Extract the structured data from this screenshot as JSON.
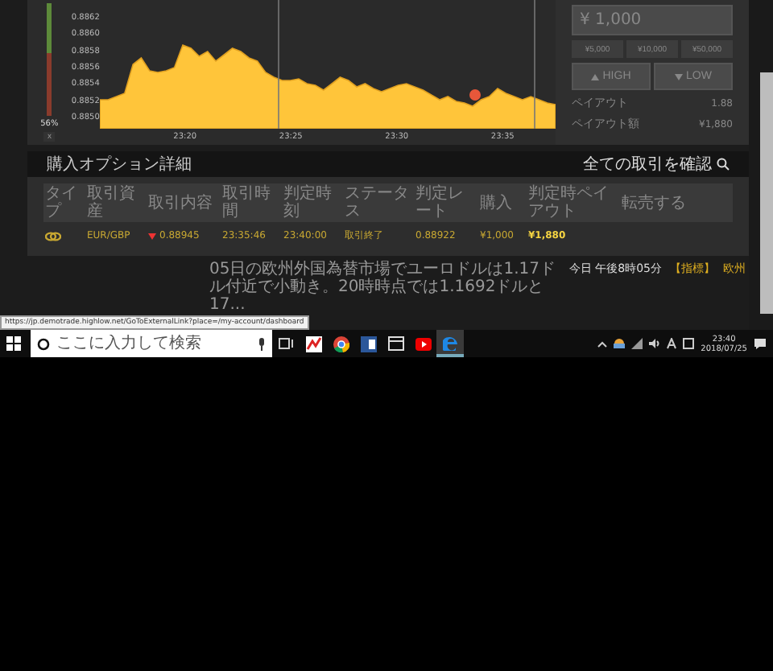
{
  "meter": {
    "label": "56%",
    "close": "x",
    "level": 0.56
  },
  "chart": {
    "yticks": [
      "0.8862",
      "0.8860",
      "0.8858",
      "0.8856",
      "0.8854",
      "0.8852",
      "0.8850"
    ],
    "xticks": [
      "23:20",
      "23:25",
      "23:30",
      "23:35"
    ]
  },
  "trade_panel": {
    "amount": "¥ 1,000",
    "presets": [
      "¥5,000",
      "¥10,000",
      "¥50,000"
    ],
    "buttons": [
      {
        "label": "HIGH",
        "kind": "high"
      },
      {
        "label": "LOW",
        "kind": "low"
      }
    ],
    "payout": [
      {
        "label": "ペイアウト",
        "value": "1.88"
      },
      {
        "label": "ペイアウト額",
        "value": "¥1,880"
      }
    ]
  },
  "options": {
    "title": "購入オプション詳細",
    "link": "全ての取引を確認",
    "columns": [
      "タイプ",
      "取引資産",
      "取引内容",
      "取引時間",
      "判定時刻",
      "ステータス",
      "判定レート",
      "購入",
      "判定時ペイアウト",
      "転売する"
    ],
    "rows": [
      {
        "asset": "EUR/GBP",
        "kind": "low",
        "rate": "0.88945",
        "time": "23:35:46",
        "expiry": "23:40:00",
        "status": "取引終了",
        "closing_rate": "0.88922",
        "amount": "¥1,000",
        "payout": "¥1,880"
      }
    ]
  },
  "ticker": {
    "text": "05日の欧州外国為替市場でユーロドルは1.17ドル付近で小動き。20時時点では1.1692ドルと17...",
    "time": "今日 午後8時05分",
    "tag": "【指標】",
    "headline": "欧州"
  },
  "status_url": "https://jp.demotrade.highlow.net/GoToExternalLink?place=/my-account/dashboard",
  "taskbar": {
    "search_placeholder": "ここに入力して検索",
    "apps": [
      {
        "kind": "highlow",
        "selected": false
      },
      {
        "kind": "chrome",
        "selected": false
      },
      {
        "kind": "word",
        "selected": false
      },
      {
        "kind": "window",
        "selected": false
      },
      {
        "kind": "youtube",
        "selected": false
      },
      {
        "kind": "edge",
        "selected": true
      }
    ],
    "time": "23:40",
    "date": "2018/07/25"
  }
}
